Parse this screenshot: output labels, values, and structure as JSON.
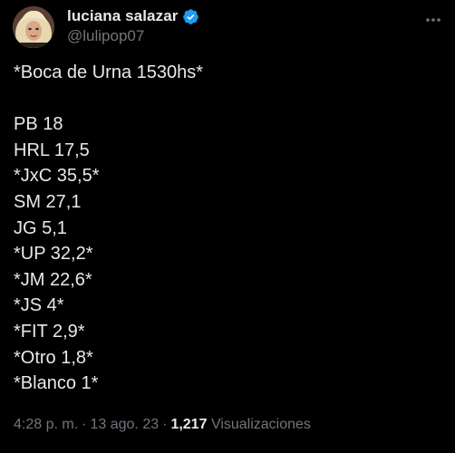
{
  "author": {
    "display_name": "luciana salazar",
    "handle": "@lulipop07",
    "verified": true,
    "avatar_icon": "profile-photo",
    "verified_icon": "verified-badge-icon",
    "verified_color": "#1d9bf0"
  },
  "more_icon": "more-options-icon",
  "tweet": {
    "lines": [
      "*Boca de Urna 1530hs*",
      "",
      "PB 18",
      "HRL 17,5",
      "*JxC 35,5*",
      "SM 27,1",
      "JG 5,1",
      "*UP 32,2*",
      "*JM 22,6*",
      "*JS 4*",
      "*FIT 2,9*",
      "*Otro 1,8*",
      "*Blanco 1*"
    ]
  },
  "meta": {
    "time": "4:28 p. m.",
    "date": "13 ago. 23",
    "separator": "·",
    "views_count": "1,217",
    "views_label": "Visualizaciones"
  },
  "colors": {
    "background": "#000000",
    "text_primary": "#e7e9ea",
    "text_secondary": "#71767b"
  }
}
